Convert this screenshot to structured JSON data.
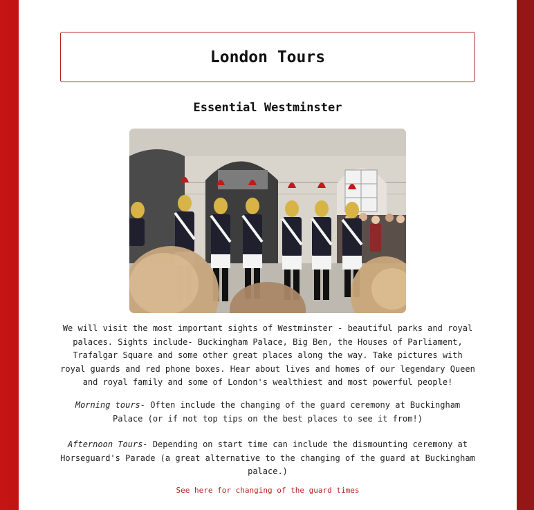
{
  "site": {
    "title": "London Tours"
  },
  "tour": {
    "heading": "Essential Westminster",
    "photo_subject": "Household Cavalry guards in red-plumed helmets lined up before stone arches, crowd watching",
    "intro": "We will visit the most important sights of Westminster - beautiful parks and royal palaces. Sights include- Buckingham Palace, Big Ben, the Houses of Parliament, Trafalgar Square and some other great places along the way. Take pictures with royal guards and red phone boxes. Hear about lives and homes of our legendary Queen and royal family and some of London's wealthiest and most powerful people!",
    "morning_label": "Morning tours-",
    "morning_text": " Often include the changing of the guard ceremony at Buckingham Palace (or if not top tips on the best places to see it from!)",
    "afternoon_label": "Afternoon Tours-",
    "afternoon_text": " Depending on start time can include the dismounting ceremony at Horseguard's Parade (a great alternative to the changing of the guard at Buckingham palace.)",
    "guard_times_link": "See here for changing of the guard times"
  },
  "colors": {
    "accent": "#b22222",
    "side_background": "#c41414"
  }
}
